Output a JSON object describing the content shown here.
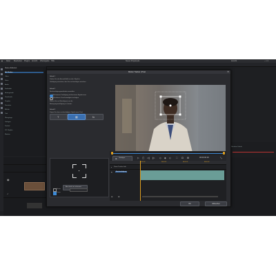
{
  "app": {
    "menu": [
      "Datei",
      "Bearbeiten",
      "Plugins",
      "Ansicht",
      "Wiedergabe",
      "Hilfe"
    ],
    "window_title": "Neues Projekt.pds",
    "right_menu": "Ansicht"
  },
  "dialog": {
    "title": "Motion Tracker | Pixel",
    "close_glyph": "✕",
    "step1_head": "Schritt 1",
    "step1_text": [
      "Ziehen Sie das Auswahlfeld um das Objekt in",
      "Verfolgung einsetzen, das Sie nachverfolgen möchten."
    ],
    "step2_head": "Schritt 2",
    "step2_sub": "Nachverfolgungsmethode auswählen",
    "radio1": "Mit bewerter Verfolgung mit besseren Ergebnissen",
    "radio2": "Mit bekannt. Geschwindigkeit verfolgen",
    "step2_note": [
      "Klicken Sie auf [Verfolgen], um die",
      "Bewegungsverfolgung zu starten."
    ],
    "step3_head": "Schritt 3",
    "step3_text": [
      "Fügen Sie dem nachverfolgten Objekt einen Titel,",
      "einen Mosaikeffekt oder einen Effekt hinzu."
    ],
    "step3_buttons": [
      "T",
      "▦",
      "fx"
    ],
    "redetect_label": "Abschnitt neu erkennen",
    "check1": "Starte",
    "check2": "Zoom",
    "ok": "OK",
    "cancel": "Abbrechen",
    "track_label": "Verfolgen",
    "timecode": "00:00:00:00",
    "tl_row1": "Zoom Tracker Info",
    "tl_row2": "Nachverfolgung",
    "ruler_ticks": [
      "00:00:00",
      "00:00:01",
      "00:00:02",
      "00:00:03",
      "00:00:04"
    ]
  },
  "library": {
    "header": "Medien-Bibliothek",
    "items": [
      "Alle Medien",
      "Video",
      "Fotos",
      "Audio",
      "Farbtafeln",
      "Hintergründe",
      "Downloads",
      "Projekte",
      "Favoriten",
      "Effekte",
      "Titel",
      "Übergänge",
      "Vorlagen",
      "Partikel",
      "PiP Objekte",
      "Masken"
    ]
  },
  "rightpanel": {
    "label": "Nächster Schritt"
  },
  "colors": {
    "accent": "#3d8ad6",
    "teal": "#6a9d97",
    "timecode": "#e0a020",
    "bg": "#1e1f22"
  }
}
